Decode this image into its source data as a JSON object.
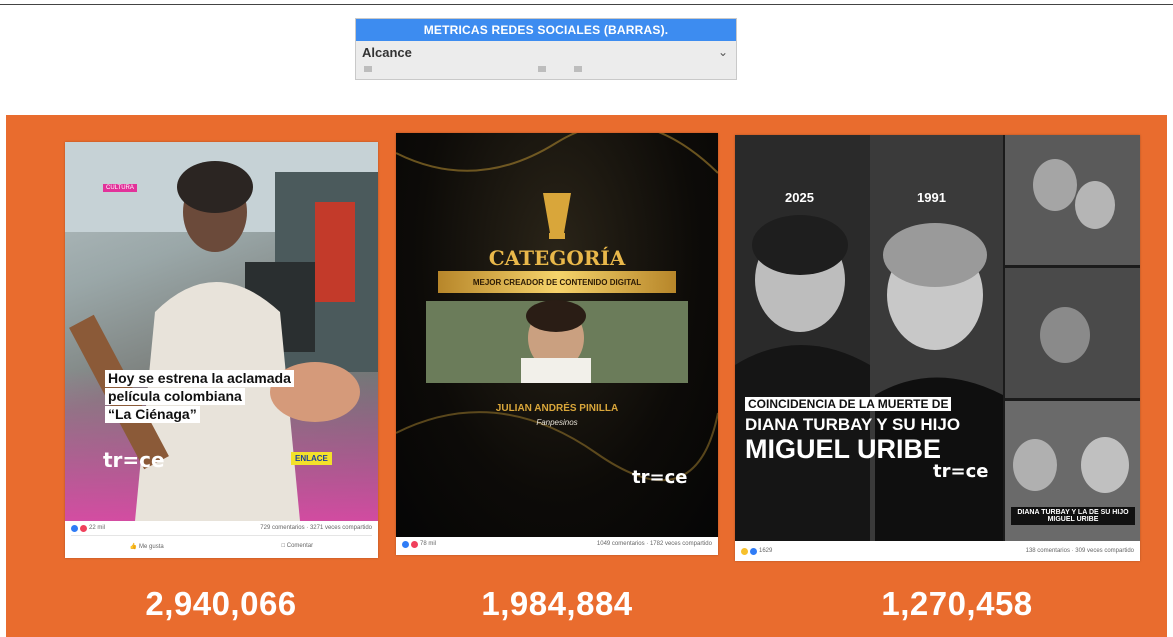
{
  "selector": {
    "title": "METRICAS REDES SOCIALES (BARRAS).",
    "selected": "Alcance"
  },
  "posts": [
    {
      "badge": "CULTURA",
      "headline_lines": [
        "Hoy se estrena la aclamada",
        "película colombiana",
        "“La Ciénaga”"
      ],
      "brand": "tr=ce",
      "sub_brand": "ENLACE",
      "reactions": "22 mil",
      "comments_shares": "729 comentarios · 3271 veces compartido",
      "like_label": "Me gusta",
      "comment_label": "Comentar",
      "metric": "2,940,066"
    },
    {
      "category_title": "CATEGORÍA",
      "category_banner": "MEJOR CREADOR DE CONTENIDO DIGITAL",
      "name": "JULIAN ANDRÉS PINILLA",
      "subtitle": "Fanpesinos",
      "brand": "tr=ce",
      "reactions": "78 mil",
      "comments_shares": "1049 comentarios · 1782 veces compartido",
      "metric": "1,984,884"
    },
    {
      "year_left": "2025",
      "year_right": "1991",
      "headline_1": "COINCIDENCIA DE LA MUERTE DE",
      "headline_2": "DIANA TURBAY Y SU HIJO",
      "headline_3": "MIGUEL URIBE",
      "brand": "tr=ce",
      "mini_caption": "DIANA TURBAY Y LA DE SU HIJO MIGUEL URIBE",
      "reactions": "1629",
      "comments_shares": "138 comentarios · 309 veces compartido",
      "metric": "1,270,458"
    }
  ],
  "colors": {
    "panel": "#e96c2e",
    "selector_header": "#3d8cf0",
    "gold": "#d9a63a"
  }
}
